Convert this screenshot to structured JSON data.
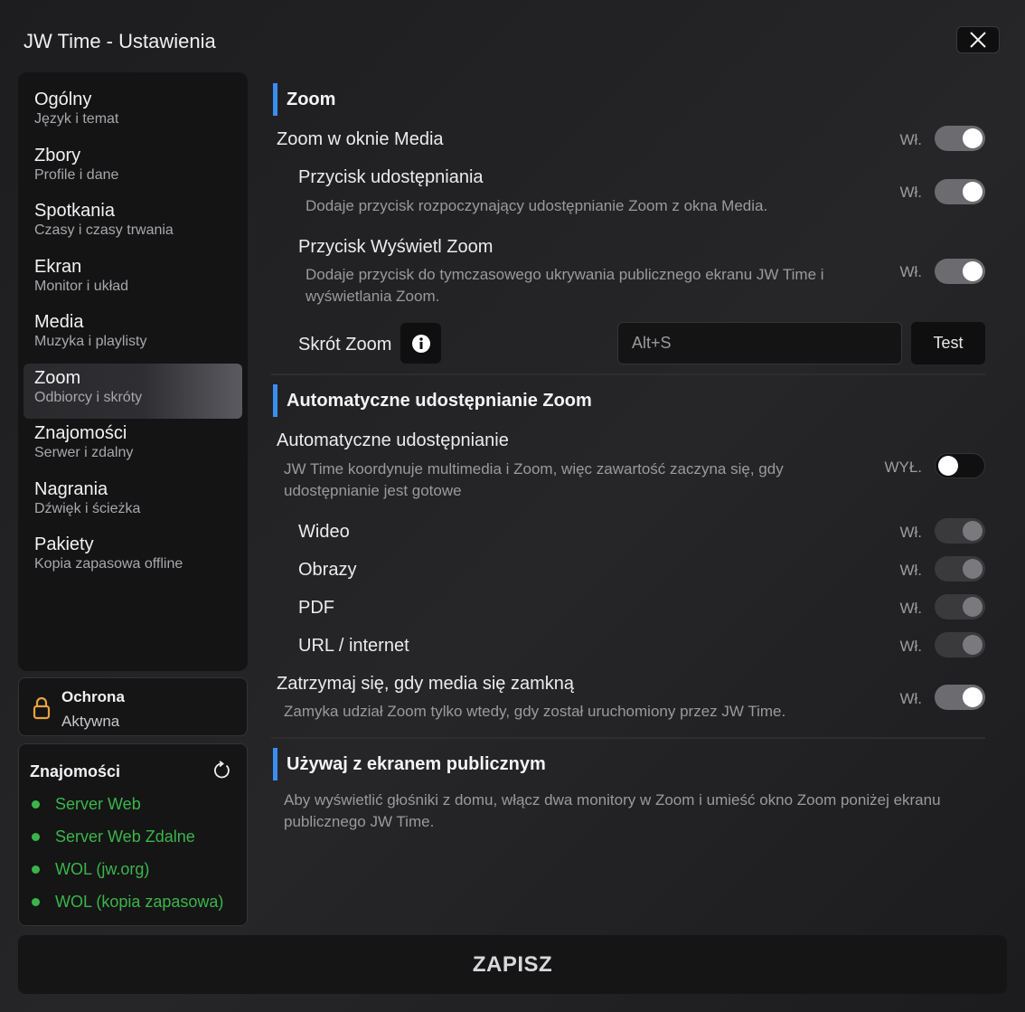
{
  "window": {
    "title": "JW Time - Ustawienia"
  },
  "sidebar": {
    "items": [
      {
        "label": "Ogólny",
        "sub": "Język i temat"
      },
      {
        "label": "Zbory",
        "sub": "Profile i dane"
      },
      {
        "label": "Spotkania",
        "sub": "Czasy i czasy trwania"
      },
      {
        "label": "Ekran",
        "sub": "Monitor i układ"
      },
      {
        "label": "Media",
        "sub": "Muzyka i playlisty"
      },
      {
        "label": "Zoom",
        "sub": "Odbiorcy i skróty"
      },
      {
        "label": "Znajomości",
        "sub": "Serwer i zdalny"
      },
      {
        "label": "Nagrania",
        "sub": "Dźwięk i ścieżka"
      },
      {
        "label": "Pakiety",
        "sub": "Kopia zapasowa offline"
      }
    ],
    "active_index": 5
  },
  "protection": {
    "title": "Ochrona",
    "status": "Aktywna",
    "icon": "lock-icon",
    "accent": "#e8a33d"
  },
  "connections": {
    "title": "Znajomości",
    "icon": "refresh-icon",
    "items": [
      "Server Web",
      "Server Web Zdalne",
      "WOL (jw.org)",
      "WOL (kopia zapasowa)"
    ],
    "status_color": "#3bb54a"
  },
  "save_label": "ZAPISZ",
  "zoom_section": {
    "title": "Zoom",
    "media_zoom": {
      "label": "Zoom w oknie Media",
      "state": "Wł.",
      "on": true
    },
    "share_button": {
      "label": "Przycisk udostępniania",
      "desc": "Dodaje przycisk rozpoczynający udostępnianie Zoom z okna Media.",
      "state": "Wł.",
      "on": true
    },
    "show_zoom_button": {
      "label": "Przycisk Wyświetl Zoom",
      "desc": "Dodaje przycisk do tymczasowego ukrywania publicznego ekranu JW Time i wyświetlania Zoom.",
      "state": "Wł.",
      "on": true
    },
    "shortcut": {
      "label": "Skrót Zoom",
      "value": "Alt+S",
      "test_label": "Test"
    }
  },
  "auto_section": {
    "title": "Automatyczne udostępnianie Zoom",
    "auto_share": {
      "label": "Automatyczne udostępnianie",
      "desc": "JW Time koordynuje multimedia i Zoom, więc zawartość zaczyna się, gdy udostępnianie jest gotowe",
      "state": "WYŁ.",
      "on": false
    },
    "types": [
      {
        "label": "Wideo",
        "state": "Wł."
      },
      {
        "label": "Obrazy",
        "state": "Wł."
      },
      {
        "label": "PDF",
        "state": "Wł."
      },
      {
        "label": "URL / internet",
        "state": "Wł."
      }
    ],
    "stop_on_close": {
      "label": "Zatrzymaj się, gdy media się zamkną",
      "desc": "Zamyka udział Zoom tylko wtedy, gdy został uruchomiony przez JW Time.",
      "state": "Wł.",
      "on": true
    }
  },
  "public_section": {
    "title": "Używaj z ekranem publicznym",
    "desc": "Aby wyświetlić głośniki z domu, włącz dwa monitory w Zoom i umieść okno Zoom poniżej ekranu publicznego JW Time."
  }
}
